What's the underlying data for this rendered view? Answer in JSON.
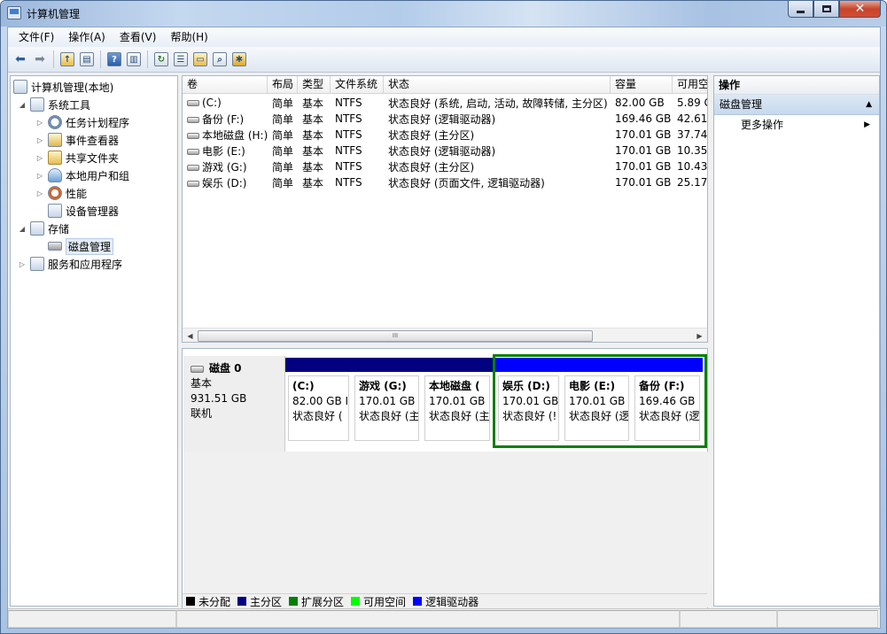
{
  "window": {
    "title": "计算机管理"
  },
  "menu": [
    "文件(F)",
    "操作(A)",
    "查看(V)",
    "帮助(H)"
  ],
  "tree": {
    "root": "计算机管理(本地)",
    "system_tools": "系统工具",
    "task_scheduler": "任务计划程序",
    "event_viewer": "事件查看器",
    "shared_folders": "共享文件夹",
    "local_users": "本地用户和组",
    "performance": "性能",
    "device_manager": "设备管理器",
    "storage": "存储",
    "disk_management": "磁盘管理",
    "services_apps": "服务和应用程序"
  },
  "volume_list": {
    "columns": [
      "卷",
      "布局",
      "类型",
      "文件系统",
      "状态",
      "容量",
      "可用空"
    ],
    "rows": [
      [
        "(C:)",
        "简单",
        "基本",
        "NTFS",
        "状态良好 (系统, 启动, 活动, 故障转储, 主分区)",
        "82.00 GB",
        "5.89 G"
      ],
      [
        "备份 (F:)",
        "简单",
        "基本",
        "NTFS",
        "状态良好 (逻辑驱动器)",
        "169.46 GB",
        "42.61"
      ],
      [
        "本地磁盘 (H:)",
        "简单",
        "基本",
        "NTFS",
        "状态良好 (主分区)",
        "170.01 GB",
        "37.74"
      ],
      [
        "电影 (E:)",
        "简单",
        "基本",
        "NTFS",
        "状态良好 (逻辑驱动器)",
        "170.01 GB",
        "10.35"
      ],
      [
        "游戏 (G:)",
        "简单",
        "基本",
        "NTFS",
        "状态良好 (主分区)",
        "170.01 GB",
        "10.43"
      ],
      [
        "娱乐 (D:)",
        "简单",
        "基本",
        "NTFS",
        "状态良好 (页面文件, 逻辑驱动器)",
        "170.01 GB",
        "25.17"
      ]
    ],
    "scroll_thumb_glyph": "III"
  },
  "disk": {
    "name": "磁盘 0",
    "type": "基本",
    "size": "931.51 GB",
    "status": "联机",
    "partitions": [
      {
        "name": "(C:)",
        "size": "82.00 GB I",
        "status": "状态良好 (",
        "bar_color": "#000080"
      },
      {
        "name": "游戏 (G:)",
        "size": "170.01 GB",
        "status": "状态良好 (主",
        "bar_color": "#000080"
      },
      {
        "name": "本地磁盘 (",
        "size": "170.01 GB",
        "status": "状态良好 (主",
        "bar_color": "#000080"
      },
      {
        "name": "娱乐 (D:)",
        "size": "170.01 GB",
        "status": "状态良好 (!",
        "bar_color": "#0000ff"
      },
      {
        "name": "电影 (E:)",
        "size": "170.01 GB",
        "status": "状态良好 (逻",
        "bar_color": "#0000ff"
      },
      {
        "name": "备份 (F:)",
        "size": "169.46 GB",
        "status": "状态良好 (逻",
        "bar_color": "#0000ff"
      }
    ]
  },
  "legend": [
    {
      "label": "未分配",
      "color": "#000000"
    },
    {
      "label": "主分区",
      "color": "#000080"
    },
    {
      "label": "扩展分区",
      "color": "#008000"
    },
    {
      "label": "可用空间",
      "color": "#00ff00"
    },
    {
      "label": "逻辑驱动器",
      "color": "#0000ff"
    }
  ],
  "actions": {
    "header": "操作",
    "section": "磁盘管理",
    "more": "更多操作"
  }
}
